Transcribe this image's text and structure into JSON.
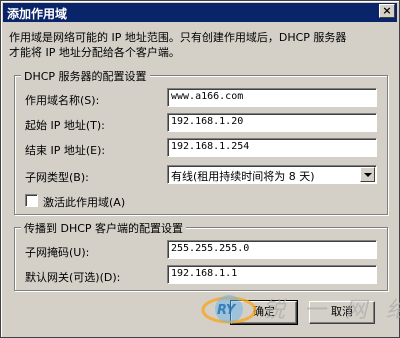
{
  "window": {
    "title": "添加作用域",
    "close_glyph": "×"
  },
  "description": {
    "line1": "作用域是网络可能的 IP 地址范围。只有创建作用域后，DHCP 服务器",
    "line2": "才能将 IP 地址分配给各个客户端。"
  },
  "dhcp_group": {
    "legend": "DHCP 服务器的配置设置",
    "scope_name_label": "作用域名称(S):",
    "scope_name_value": "www.a166.com",
    "start_ip_label": "起始 IP 地址(T):",
    "start_ip_value": "192.168.1.20",
    "end_ip_label": "结束 IP 地址(E):",
    "end_ip_value": "192.168.1.254",
    "subnet_type_label": "子网类型(B):",
    "subnet_type_value": "有线(租用持续时间将为 8 天)",
    "activate_label": "激活此作用域(A)",
    "activate_checked": false
  },
  "client_group": {
    "legend": "传播到 DHCP 客户端的配置设置",
    "mask_label": "子网掩码(U):",
    "mask_value": "255.255.255.0",
    "gateway_label": "默认网关(可选)(D):",
    "gateway_value": "192.168.1.1"
  },
  "buttons": {
    "ok_label": "确定",
    "cancel_label": "取消"
  },
  "watermark": {
    "logo_text": "RY",
    "text": "锐 一 网 络"
  }
}
